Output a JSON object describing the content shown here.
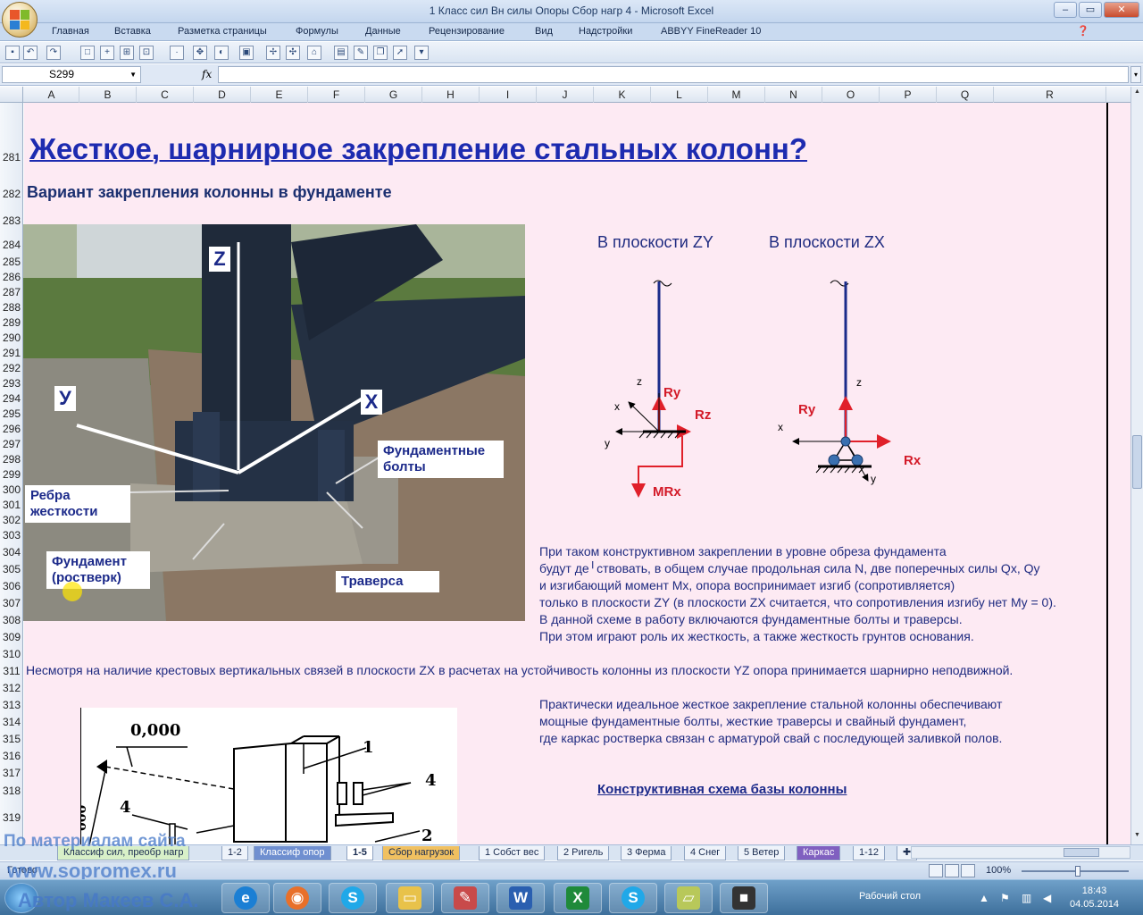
{
  "window": {
    "title": "1 Класс сил Вн силы Опоры Сбор нагр 4  -  Microsoft Excel",
    "controls": [
      "–",
      "▭",
      "✕"
    ]
  },
  "ribbon": {
    "tabs": [
      "Главная",
      "Вставка",
      "Разметка страницы",
      "Формулы",
      "Данные",
      "Рецензирование",
      "Вид",
      "Надстройки",
      "ABBYY FineReader 10"
    ]
  },
  "formula_bar": {
    "name_box": "S299",
    "fx_label": "fx",
    "value": ""
  },
  "columns": [
    "A",
    "B",
    "C",
    "D",
    "E",
    "F",
    "G",
    "H",
    "I",
    "J",
    "K",
    "L",
    "M",
    "N",
    "O",
    "P",
    "Q",
    "R"
  ],
  "rows": [
    "281",
    "282",
    "283",
    "284",
    "285",
    "286",
    "287",
    "288",
    "289",
    "290",
    "291",
    "292",
    "293",
    "294",
    "295",
    "296",
    "297",
    "298",
    "299",
    "300",
    "301",
    "302",
    "303",
    "304",
    "305",
    "306",
    "307",
    "308",
    "309",
    "310",
    "311",
    "312",
    "313",
    "314",
    "315",
    "316",
    "317",
    "318",
    "319"
  ],
  "content": {
    "title": "Жесткое, шарнирное закрепление стальных колонн?",
    "subtitle": "Вариант закрепления колонны в фундаменте",
    "photo": {
      "axis_z": "Z",
      "axis_y": "У",
      "axis_x": "Х",
      "callout_bolts": "Фундаментные болты",
      "callout_ribs": "Ребра жесткости",
      "callout_foundation": "Фундамент (ростверк)",
      "callout_traverse": "Траверса"
    },
    "plane_zy": "В плоскости ZY",
    "plane_zx": "В плоскости ZX",
    "scheme_zy": {
      "z": "z",
      "x": "x",
      "y": "y",
      "Ry": "Ry",
      "Rz": "Rz",
      "MRx": "MRx"
    },
    "scheme_zx": {
      "z": "z",
      "x": "x",
      "y": "y",
      "Ry": "Ry",
      "Rx": "Rx"
    },
    "para1": [
      "При таком конструктивном закреплении в уровне обреза фундамента",
      "будут де╵ствовать, в общем случае продольная сила N, две поперечных силы Qx, Qy",
      "и изгибающий момент Mx, опора воспринимает изгиб  (сопротивляется)",
      "только в плоскости ZY (в плоскости ZX считается, что сопротивления изгибу нет My = 0).",
      "В данной схеме в работу включаются фундаментные болты и траверсы.",
      "При этом играют роль их жесткость, а также жесткость грунтов основания."
    ],
    "note": "Несмотря на наличие крестовых вертикальных связей в плоскости ZX в расчетах на устойчивость колонны из плоскости YZ опора принимается шарнирно неподвижной.",
    "para2": [
      "Практически идеальное жесткое закрепление стальной колонны обеспечивают",
      "мощные фундаментные болты, жесткие траверсы и свайный фундамент,",
      "где каркас ростверка связан с арматурой свай с последующей заливкой полов."
    ],
    "link": "Конструктивная схема базы колонны",
    "drawing": {
      "level": "0,000",
      "n1": "1",
      "n2": "2",
      "n4a": "4",
      "n4b": "4",
      "side": "000"
    }
  },
  "sheet_tabs": [
    "Классиф сил, преобр нагр",
    "1-2",
    "Классиф опор",
    "1-5",
    "Сбор нагрузок",
    "1 Собст вес",
    "2 Ригель",
    "3 Ферма",
    "4 Снег",
    "5 Ветер",
    "Каркас",
    "1-12"
  ],
  "status": {
    "ready": "Готово",
    "zoom": "100%"
  },
  "taskbar": {
    "desktop_label": "Рабочий стол",
    "time": "18:43",
    "date": "04.05.2014"
  },
  "watermark": {
    "line1": "По материалам сайта",
    "line2": "www.sopromex.ru",
    "line3": "Автор Макеев С.А."
  }
}
